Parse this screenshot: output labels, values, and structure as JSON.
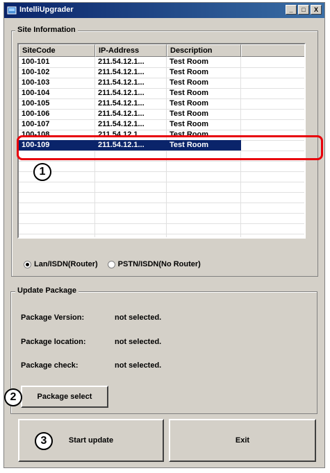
{
  "window": {
    "title": "IntelliUpgrader",
    "buttons": [
      "_",
      "□",
      "X"
    ]
  },
  "site_info": {
    "group_label": "Site Information",
    "columns": [
      "SiteCode",
      "IP-Address",
      "Description"
    ],
    "rows": [
      [
        "100-101",
        "211.54.12.1...",
        "Test Room"
      ],
      [
        "100-102",
        "211.54.12.1...",
        "Test Room"
      ],
      [
        "100-103",
        "211.54.12.1...",
        "Test Room"
      ],
      [
        "100-104",
        "211.54.12.1...",
        "Test Room"
      ],
      [
        "100-105",
        "211.54.12.1...",
        "Test Room"
      ],
      [
        "100-106",
        "211.54.12.1...",
        "Test Room"
      ],
      [
        "100-107",
        "211.54.12.1...",
        "Test Room"
      ],
      [
        "100-108",
        "211.54.12.1...",
        "Test Room"
      ],
      [
        "100-109",
        "211.54.12.1...",
        "Test Room"
      ]
    ],
    "selected_row": 8,
    "radio_options": [
      "Lan/ISDN(Router)",
      "PSTN/ISDN(No Router)"
    ],
    "radio_selected": 0
  },
  "update_package": {
    "group_label": "Update Package",
    "fields": [
      {
        "label": "Package Version:",
        "value": "not selected."
      },
      {
        "label": "Package location:",
        "value": "not selected."
      },
      {
        "label": "Package check:",
        "value": "not selected."
      }
    ],
    "select_button": "Package select"
  },
  "actions": {
    "start_update": "Start update",
    "exit": "Exit"
  },
  "markers": [
    "1",
    "2",
    "3"
  ],
  "colors": {
    "highlight": "#e8000a",
    "selection": "#0a246a",
    "title_bar": "#0a246a"
  }
}
